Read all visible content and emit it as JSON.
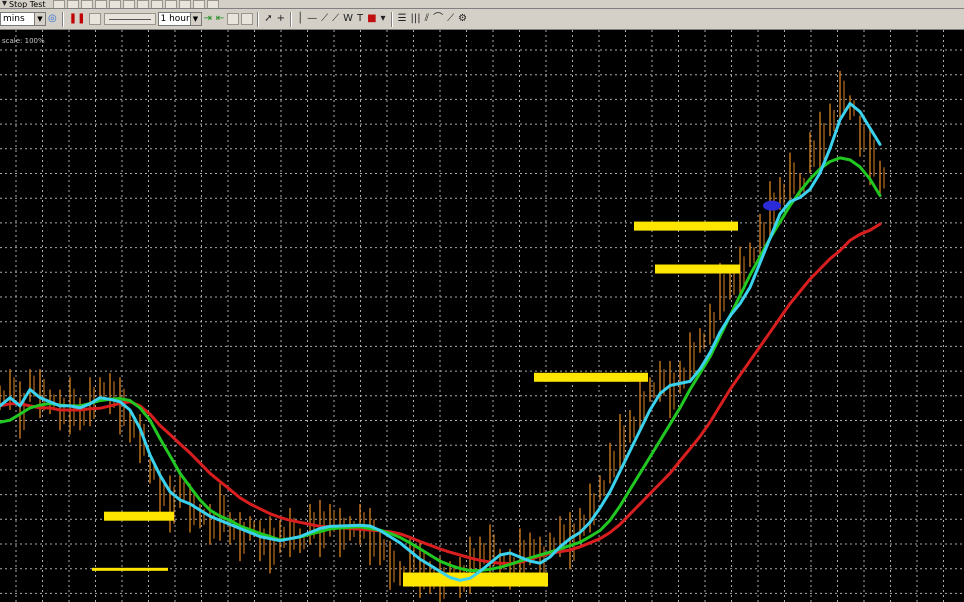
{
  "toolbar_top": {
    "stop_test_label": "Stop Test"
  },
  "toolbar": {
    "symbol_select": "mins",
    "period_select": "1 hour",
    "pause_icon": "pause-icon",
    "text_tool": "T"
  },
  "chart": {
    "scale_label": "scale: 100%"
  },
  "chart_data": {
    "type": "line",
    "background": "#000000",
    "grid": true,
    "grid_color": "#c8c8c8",
    "x": [
      0,
      10,
      20,
      30,
      40,
      50,
      60,
      70,
      80,
      90,
      100,
      110,
      120,
      130,
      140,
      150,
      160,
      170,
      180,
      190,
      200,
      210,
      220,
      230,
      240,
      250,
      260,
      270,
      280,
      290,
      300,
      310,
      320,
      330,
      340,
      350,
      360,
      370,
      380,
      390,
      400,
      410,
      420,
      430,
      440,
      450,
      460,
      470,
      480,
      490,
      500,
      510,
      520,
      530,
      540,
      550,
      560,
      570,
      580,
      590,
      600,
      610,
      620,
      630,
      640,
      650,
      660,
      670,
      680,
      690,
      700,
      710,
      720,
      730,
      740,
      750,
      760,
      770,
      780,
      790,
      800,
      810,
      820,
      830,
      840,
      850,
      860,
      870,
      880
    ],
    "series": [
      {
        "color": "#d81e1e",
        "values": [
          38.0,
          38.5,
          38.5,
          38.0,
          37.5,
          37.5,
          37.0,
          37.0,
          37.0,
          37.3,
          37.4,
          38.0,
          38.6,
          39.0,
          38.0,
          36.0,
          33.2,
          31.0,
          28.7,
          26.5,
          24.0,
          21.5,
          19.5,
          17.5,
          15.5,
          14.0,
          12.8,
          11.6,
          10.7,
          10.0,
          9.5,
          9.0,
          8.5,
          8.4,
          8.2,
          8.0,
          7.8,
          7.6,
          7.4,
          7.2,
          6.7,
          5.8,
          4.8,
          3.9,
          3.0,
          2.2,
          1.5,
          0.8,
          0.2,
          -0.2,
          -0.5,
          -0.6,
          -0.3,
          0.4,
          1.2,
          1.9,
          2.3,
          2.7,
          3.5,
          4.5,
          5.5,
          7.0,
          9.0,
          11.5,
          14.0,
          16.5,
          19.0,
          21.5,
          24.5,
          27.5,
          30.5,
          34.0,
          38.0,
          42.0,
          45.5,
          49.0,
          52.5,
          56.0,
          59.5,
          63.0,
          66.0,
          69.0,
          71.5,
          74.0,
          76.0,
          78.5,
          80.0,
          81.0,
          82.5
        ]
      },
      {
        "color": "#21c821",
        "values": [
          34.0,
          34.5,
          36.0,
          37.5,
          38.2,
          38.6,
          38.2,
          38.0,
          38.0,
          38.6,
          39.3,
          39.6,
          39.8,
          39.3,
          37.5,
          34.5,
          30.0,
          25.8,
          21.5,
          18.2,
          15.0,
          12.5,
          11.0,
          10.0,
          8.6,
          7.7,
          6.8,
          6.0,
          5.2,
          5.5,
          5.9,
          6.6,
          7.2,
          7.9,
          8.1,
          8.3,
          8.4,
          8.0,
          7.6,
          6.8,
          5.8,
          4.5,
          3.0,
          1.5,
          0.0,
          -1.0,
          -1.8,
          -2.3,
          -2.3,
          -2.0,
          -1.5,
          -0.8,
          0.0,
          0.8,
          1.5,
          2.2,
          3.0,
          3.8,
          4.6,
          6.0,
          7.5,
          10.0,
          13.5,
          17.5,
          21.5,
          25.5,
          29.5,
          33.5,
          37.5,
          42.0,
          46.0,
          50.0,
          55.0,
          60.0,
          65.0,
          70.0,
          74.5,
          79.0,
          83.0,
          87.0,
          90.5,
          93.5,
          96.0,
          97.8,
          98.7,
          98.2,
          96.5,
          93.5,
          89.5
        ]
      },
      {
        "color": "#3ad2ee",
        "values": [
          38.0,
          40.0,
          38.0,
          42.0,
          40.0,
          39.0,
          38.0,
          38.0,
          37.5,
          38.5,
          40.0,
          39.6,
          39.0,
          37.0,
          32.5,
          26.0,
          21.0,
          17.0,
          15.0,
          14.0,
          12.5,
          11.0,
          10.0,
          9.0,
          8.0,
          7.0,
          6.0,
          5.5,
          5.0,
          5.5,
          6.0,
          7.0,
          8.0,
          8.5,
          8.6,
          8.7,
          8.8,
          8.6,
          7.5,
          6.0,
          4.5,
          2.5,
          0.5,
          -1.0,
          -2.5,
          -4.0,
          -4.7,
          -4.2,
          -2.5,
          -0.5,
          1.5,
          2.0,
          1.0,
          0.0,
          -0.5,
          1.0,
          3.5,
          5.5,
          7.0,
          9.5,
          13.0,
          17.0,
          22.0,
          27.0,
          32.0,
          37.0,
          41.0,
          43.0,
          43.5,
          44.0,
          47.0,
          51.0,
          56.0,
          60.0,
          63.0,
          67.0,
          73.0,
          79.0,
          85.0,
          88.0,
          89.0,
          91.0,
          95.0,
          101.0,
          108.0,
          112.0,
          110.0,
          106.0,
          102.0
        ]
      }
    ],
    "price_bars": {
      "color": "#c8781e",
      "values": [
        40.0,
        42.0,
        37.0,
        43.0,
        41.0,
        39.0,
        37.0,
        38.0,
        36.0,
        39.0,
        42.0,
        41.0,
        38.0,
        33.0,
        30.0,
        22.0,
        17.0,
        14.0,
        17.0,
        13.0,
        11.0,
        9.0,
        12.0,
        8.0,
        6.0,
        8.0,
        5.0,
        4.0,
        6.0,
        7.0,
        5.0,
        9.0,
        8.0,
        10.0,
        7.0,
        8.0,
        9.0,
        6.0,
        3.0,
        -1.0,
        -3.0,
        1.0,
        -2.0,
        -4.0,
        -5.0,
        -3.0,
        -4.0,
        -1.0,
        2.0,
        3.0,
        0.0,
        -2.0,
        1.0,
        3.0,
        0.0,
        4.0,
        6.0,
        5.0,
        9.0,
        13.0,
        18.0,
        24.0,
        29.0,
        33.0,
        38.0,
        42.0,
        44.0,
        42.0,
        45.0,
        50.0,
        54.0,
        58.0,
        66.0,
        68.0,
        71.0,
        75.0,
        80.0,
        86.0,
        90.0,
        94.0,
        92.0,
        100.0,
        103.0,
        108.0,
        114.0,
        111.0,
        104.0,
        99.0,
        94.0
      ]
    },
    "highlight_marker": {
      "x": 772,
      "y": 87.0,
      "color": "#2a2ad8"
    },
    "annotations": [
      {
        "x0": 104,
        "x1": 174,
        "y": 11.0,
        "color": "#ffe600",
        "thickness": "thick"
      },
      {
        "x0": 92,
        "x1": 168,
        "y": -2.0,
        "color": "#ffe600",
        "thickness": "thin"
      },
      {
        "x0": 403,
        "x1": 548,
        "y": -4.5,
        "color": "#ffe600",
        "thickness": "block"
      },
      {
        "x0": 534,
        "x1": 648,
        "y": 45.0,
        "color": "#ffe600",
        "thickness": "thick"
      },
      {
        "x0": 634,
        "x1": 738,
        "y": 82.0,
        "color": "#ffe600",
        "thickness": "thick"
      },
      {
        "x0": 655,
        "x1": 740,
        "y": 71.5,
        "color": "#ffe600",
        "thickness": "thick"
      }
    ],
    "xlim": [
      0,
      964
    ],
    "ylim": [
      -10,
      130
    ]
  }
}
